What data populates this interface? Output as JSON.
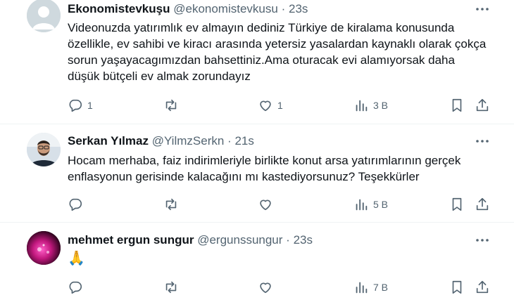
{
  "tweets": [
    {
      "name": "Ekonomistevkuşu",
      "handle": "@ekonomistevkusu",
      "dot": "·",
      "time": "23s",
      "text": "Videonuzda yatırımlık ev almayın dediniz Türkiye de kiralama konusunda özellikle, ev sahibi ve kiracı arasında yetersiz yasalardan kaynaklı olarak çokça sorun yaşayacagımızdan bahsettiniz.Ama oturacak evi alamıyorsak daha düşük bütçeli ev almak zorundayız",
      "replies": "1",
      "retweets": "",
      "likes": "1",
      "views": "3 B",
      "avatar": "default-avatar"
    },
    {
      "name": "Serkan Yılmaz",
      "handle": "@YilmzSerkn",
      "dot": "·",
      "time": "21s",
      "text": "Hocam merhaba, faiz indirimleriyle birlikte konut arsa yatırımlarının gerçek enflasyonun gerisinde  kalacağını mı kastediyorsunuz? Teşekkürler",
      "replies": "",
      "retweets": "",
      "likes": "",
      "views": "5 B",
      "avatar": "photo-avatar"
    },
    {
      "name": "mehmet ergun sungur",
      "handle": "@ergunssungur",
      "dot": "·",
      "time": "23s",
      "text": "🙏",
      "replies": "",
      "retweets": "",
      "likes": "",
      "views": "7 B",
      "avatar": "pink-avatar"
    }
  ],
  "colors": {
    "text": "#0f1419",
    "secondary": "#536471",
    "divider": "#eff3f4"
  },
  "icons": [
    "more-icon",
    "reply-icon",
    "retweet-icon",
    "like-icon",
    "views-icon",
    "bookmark-icon",
    "share-icon"
  ]
}
